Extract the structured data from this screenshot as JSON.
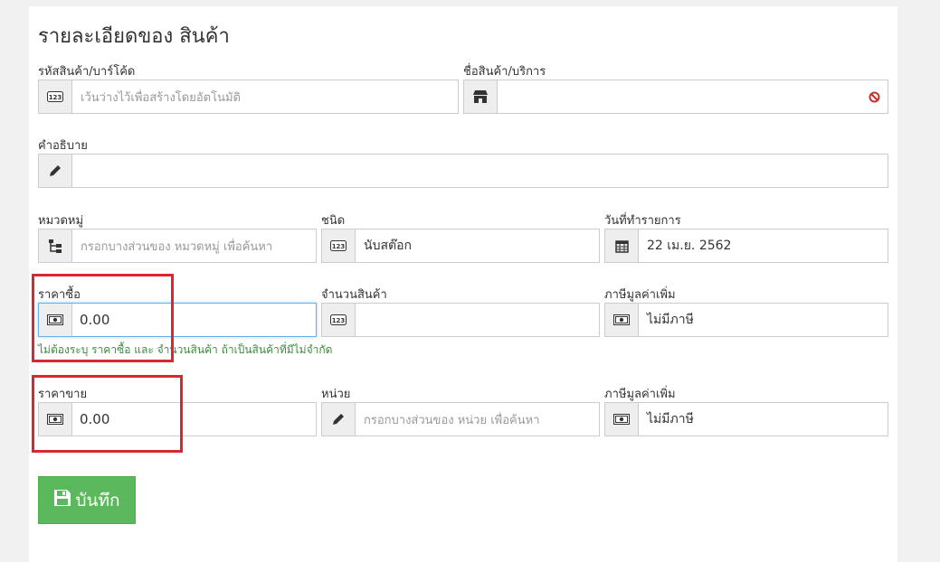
{
  "page": {
    "title": "รายละเอียดของ สินค้า"
  },
  "fields": {
    "code": {
      "label": "รหัสสินค้า/บาร์โค้ด",
      "placeholder": "เว้นว่างไว้เพื่อสร้างโดยอัตโนมัติ",
      "icon": "number-123-icon"
    },
    "name": {
      "label": "ชื่อสินค้า/บริการ",
      "value": "",
      "icon": "store-icon",
      "status_icon": "required-ban-icon"
    },
    "description": {
      "label": "คำอธิบาย",
      "value": "",
      "icon": "pencil-icon"
    },
    "category": {
      "label": "หมวดหมู่",
      "placeholder": "กรอกบางส่วนของ หมวดหมู่ เพื่อค้นหา",
      "icon": "sitemap-icon"
    },
    "type": {
      "label": "ชนิด",
      "value": "นับสต๊อก",
      "icon": "number-123-icon"
    },
    "date": {
      "label": "วันที่ทำรายการ",
      "value": "22 เม.ย. 2562",
      "icon": "calendar-icon"
    },
    "purchase_price": {
      "label": "ราคาซื้อ",
      "value": "0.00",
      "icon": "money-icon"
    },
    "quantity": {
      "label": "จำนวนสินค้า",
      "value": "",
      "icon": "number-123-icon"
    },
    "vat_purchase": {
      "label": "ภาษีมูลค่าเพิ่ม",
      "value": "ไม่มีภาษี",
      "icon": "money-icon"
    },
    "sale_price": {
      "label": "ราคาขาย",
      "value": "0.00",
      "icon": "money-icon"
    },
    "unit": {
      "label": "หน่วย",
      "placeholder": "กรอกบางส่วนของ หน่วย เพื่อค้นหา",
      "icon": "pencil-icon"
    },
    "vat_sale": {
      "label": "ภาษีมูลค่าเพิ่ม",
      "value": "ไม่มีภาษี",
      "icon": "money-icon"
    }
  },
  "help_text": "ไม่ต้องระบุ ราคาซื้อ และ จำนวนสินค้า ถ้าเป็นสินค้าที่มีไม่จำกัด",
  "save_button": {
    "label": "บันทึก",
    "icon": "floppy-disk-icon"
  },
  "colors": {
    "highlight": "#d9262f",
    "save": "#5cb85c",
    "help": "#3c8d3c",
    "required": "#c9302c"
  }
}
